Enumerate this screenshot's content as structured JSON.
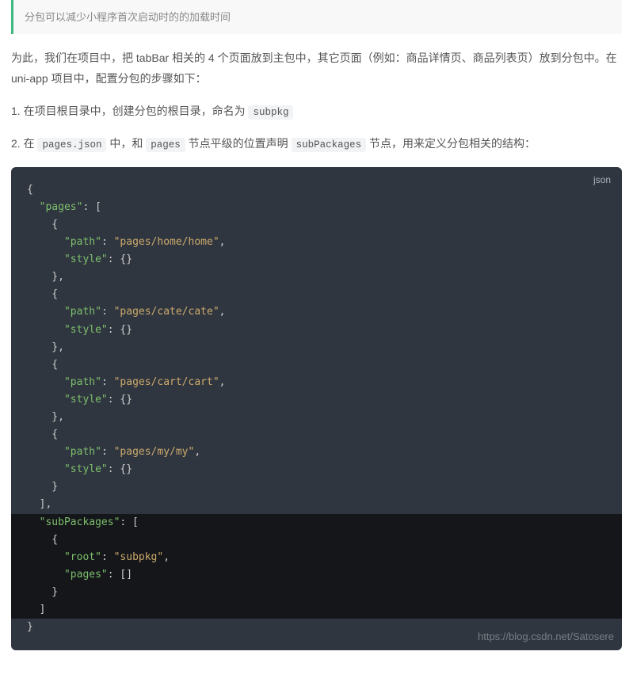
{
  "tip": "分包可以减少小程序首次启动时的的加载时间",
  "intro": {
    "p1_a": "为此，我们在项目中，把 tabBar 相关的 4 个页面放到主包中，其它页面（例如：商品详情页、商品列表页）放到分包中。在 uni-app 项目中，配置分包的步骤如下：",
    "li1_a": "1. 在项目根目录中，创建分包的根目录，命名为 ",
    "li1_code": "subpkg",
    "li2_a": "2. 在 ",
    "li2_code1": "pages.json",
    "li2_b": " 中，和 ",
    "li2_code2": "pages",
    "li2_c": " 节点平级的位置声明 ",
    "li2_code3": "subPackages",
    "li2_d": " 节点，用来定义分包相关的结构："
  },
  "code": {
    "lang": "json",
    "lines": {
      "l0": "{",
      "pages_key": "\"pages\"",
      "colon_bracket": ": [",
      "brace_open": "    {",
      "path_key": "\"path\"",
      "path_v1": "\"pages/home/home\"",
      "path_v2": "\"pages/cate/cate\"",
      "path_v3": "\"pages/cart/cart\"",
      "path_v4": "\"pages/my/my\"",
      "style_key": "\"style\"",
      "style_val": ": {}",
      "brace_close_comma": "    },",
      "brace_close": "    }",
      "bracket_close_comma": "  ],",
      "sub_key": "\"subPackages\"",
      "root_key": "\"root\"",
      "root_val": "\"subpkg\"",
      "pages_empty": ": []",
      "bracket_close": "  ]",
      "end": "}"
    }
  },
  "watermark": "https://blog.csdn.net/Satosere"
}
